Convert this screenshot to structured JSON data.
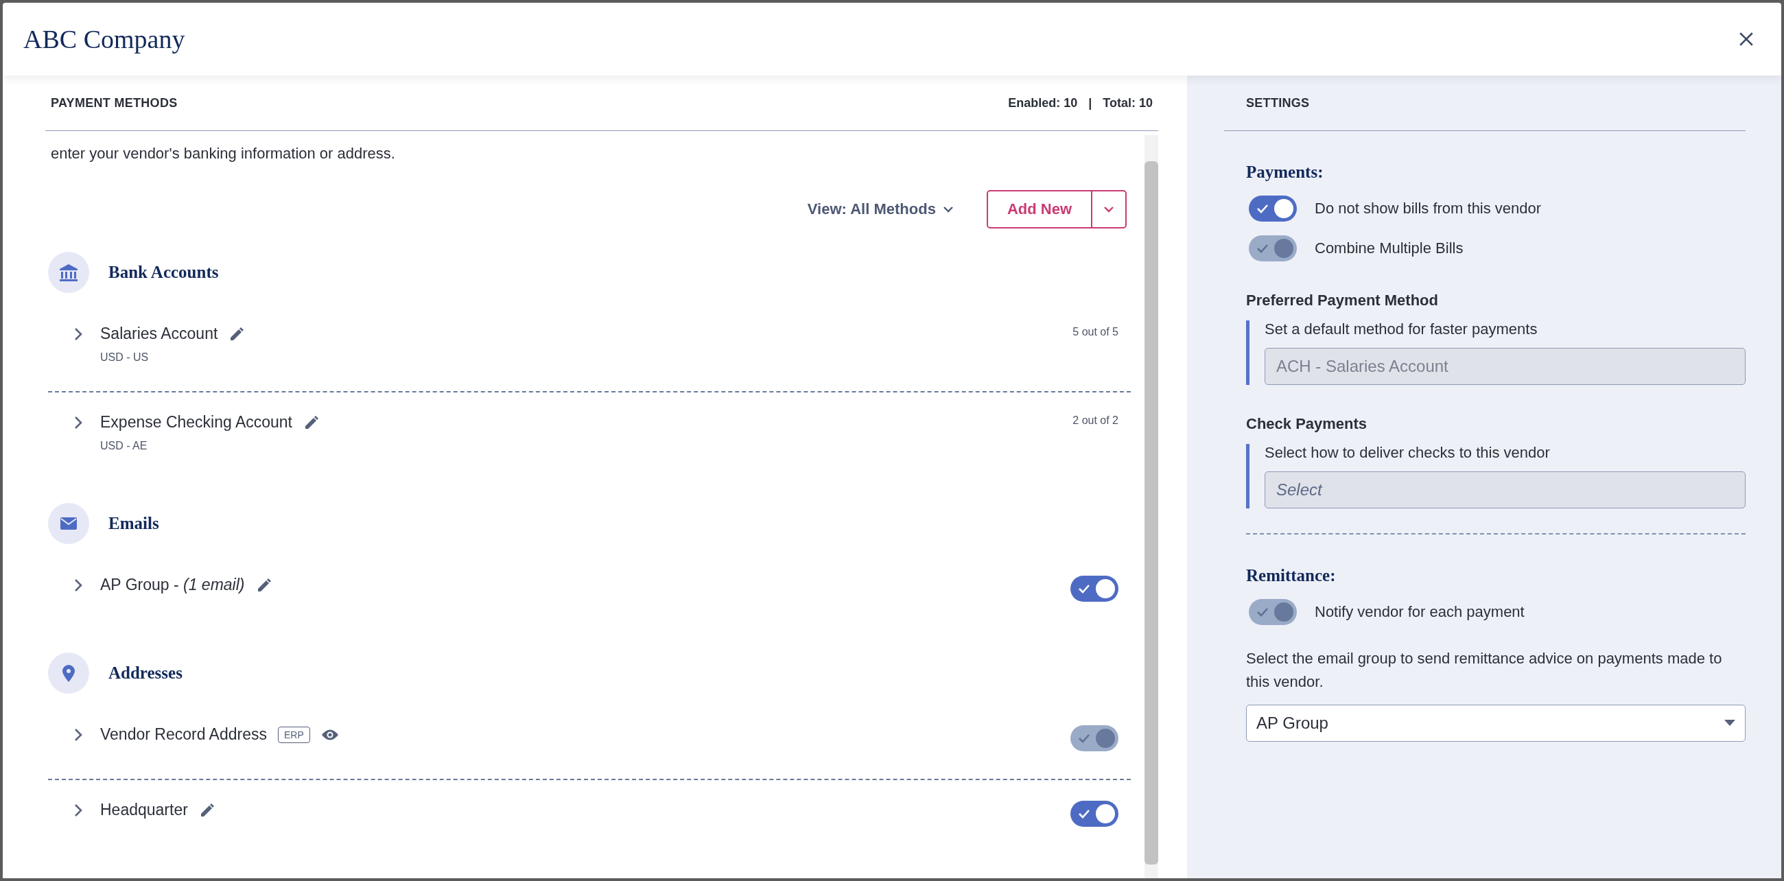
{
  "window": {
    "title": "ABC Company"
  },
  "payment_methods": {
    "heading": "PAYMENT METHODS",
    "enabled": "Enabled: 10",
    "separator": "|",
    "total": "Total: 10",
    "intro": "enter your vendor's banking information or address.",
    "view_filter": "View: All Methods",
    "add_button": "Add New",
    "sections": [
      {
        "kind": "bank",
        "title": "Bank Accounts",
        "items": [
          {
            "name": "Salaries Account",
            "kind": "edit",
            "subtitle": "USD - US",
            "count": "5 out of 5"
          },
          {
            "name": "Expense Checking Account",
            "kind": "edit",
            "subtitle": "USD - AE",
            "count": "2 out of 2"
          }
        ]
      },
      {
        "kind": "email",
        "title": "Emails",
        "items": [
          {
            "name": "AP Group - *(1 email)*",
            "kind": "edit",
            "toggle": {
              "on": true,
              "disabled": false
            }
          }
        ]
      },
      {
        "kind": "address",
        "title": "Addresses",
        "items": [
          {
            "name": "Vendor Record Address",
            "badge": "ERP",
            "kind": "view",
            "toggle": {
              "on": true,
              "disabled": true
            }
          },
          {
            "name": "Headquarter",
            "kind": "edit",
            "toggle": {
              "on": true,
              "disabled": false
            }
          }
        ]
      }
    ]
  },
  "settings": {
    "heading": "SETTINGS",
    "payments": {
      "title": "Payments:",
      "toggles": [
        {
          "label": "Do not show bills from this vendor",
          "on": true,
          "disabled": false
        },
        {
          "label": "Combine Multiple Bills",
          "on": true,
          "disabled": true
        }
      ]
    },
    "preferred": {
      "title": "Preferred Payment Method",
      "hint": "Set a default method for faster payments",
      "value": "ACH - Salaries Account"
    },
    "check": {
      "title": "Check Payments",
      "hint": "Select how to deliver checks to this vendor",
      "placeholder": "Select"
    },
    "remittance": {
      "title": "Remittance:",
      "toggle": {
        "label": "Notify vendor for each payment",
        "on": true,
        "disabled": true
      },
      "text": "Select the email group to send remittance advice on payments made to this vendor.",
      "select_value": "AP Group"
    }
  }
}
